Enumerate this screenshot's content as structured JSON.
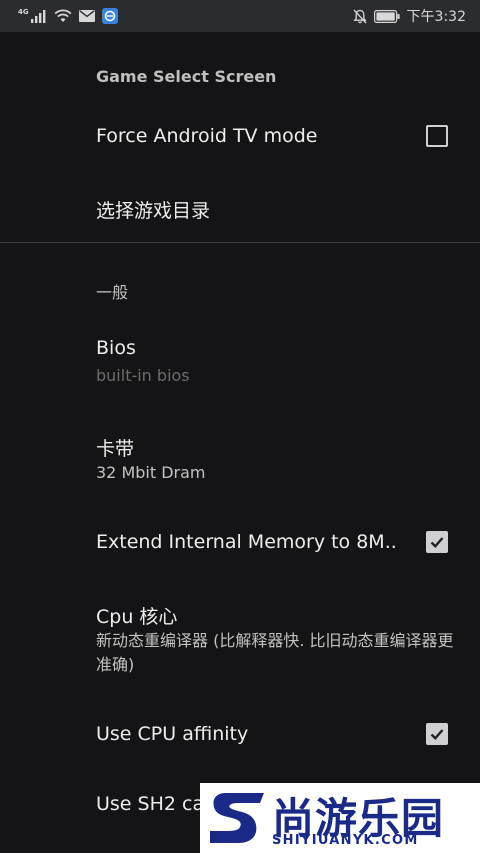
{
  "status_bar": {
    "network": "4G",
    "time": "下午3:32"
  },
  "settings": {
    "section_game_select": "Game Select Screen",
    "force_tv_mode": {
      "title": "Force Android TV mode",
      "checked": false
    },
    "select_game_dir": {
      "title": "选择游戏目录"
    },
    "section_general": "一般",
    "bios": {
      "title": "Bios",
      "summary": "built-in bios"
    },
    "cartridge": {
      "title": "卡带",
      "summary": "32 Mbit Dram"
    },
    "extend_memory": {
      "title": "Extend Internal Memory to 8M..",
      "checked": true
    },
    "cpu_core": {
      "title": "Cpu 核心",
      "summary": "新动态重编译器 (比解释器快. 比旧动态重编译器更准确)"
    },
    "cpu_affinity": {
      "title": "Use CPU affinity",
      "checked": true
    },
    "sh2_cache": {
      "title": "Use SH2 ca"
    }
  },
  "watermark": {
    "text": "尚游乐园",
    "subtext": "SHIYIUANYK.COM"
  }
}
